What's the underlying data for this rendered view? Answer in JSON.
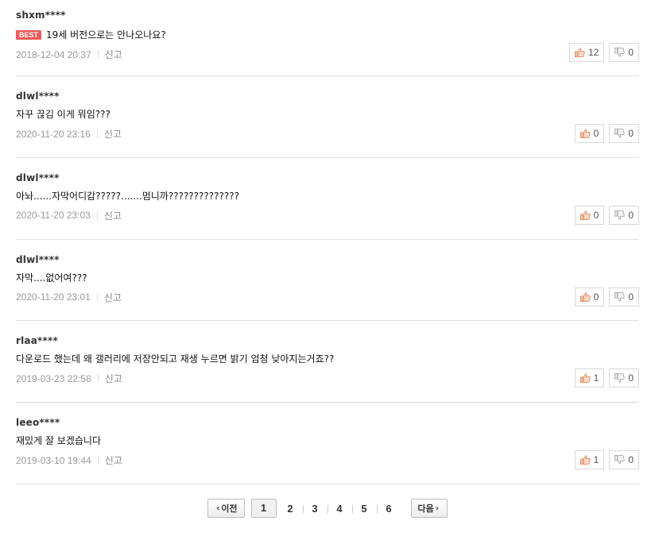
{
  "comments": [
    {
      "author": "shxm****",
      "best_label": "BEST",
      "text": "19세 버전으로는 안나오나요?",
      "date": "2018-12-04 20:37",
      "report_label": "신고",
      "likes": "12",
      "dislikes": "0"
    },
    {
      "author": "dlwl****",
      "text": "자꾸 끊김 이게 뭐임???",
      "date": "2020-11-20 23:16",
      "report_label": "신고",
      "likes": "0",
      "dislikes": "0"
    },
    {
      "author": "dlwl****",
      "text": "아놔......자막어디감?????.......멈니까??????????????",
      "date": "2020-11-20 23:03",
      "report_label": "신고",
      "likes": "0",
      "dislikes": "0"
    },
    {
      "author": "dlwl****",
      "text": "자막....없어여???",
      "date": "2020-11-20 23:01",
      "report_label": "신고",
      "likes": "0",
      "dislikes": "0"
    },
    {
      "author": "rlaa****",
      "text": "다운로드 했는데 왜 갤러리에 저장안되고 재생 누르면 밝기 엄청 낮아지는거죠??",
      "date": "2019-03-23 22:58",
      "report_label": "신고",
      "likes": "1",
      "dislikes": "0"
    },
    {
      "author": "leeo****",
      "text": "재밌게 잘 보겠습니다",
      "date": "2019-03-10 19:44",
      "report_label": "신고",
      "likes": "1",
      "dislikes": "0"
    }
  ],
  "pagination": {
    "prev_label": "이전",
    "next_label": "다음",
    "pages": [
      "1",
      "2",
      "3",
      "4",
      "5",
      "6"
    ],
    "current": "1"
  },
  "icons": {
    "like": "thumbs-up-icon",
    "dislike": "thumbs-down-icon",
    "prev": "chevron-left-icon",
    "next": "chevron-right-icon"
  },
  "colors": {
    "best_badge": "#f25a5a",
    "like_icon": "#e8906a",
    "divider": "#dedede"
  }
}
